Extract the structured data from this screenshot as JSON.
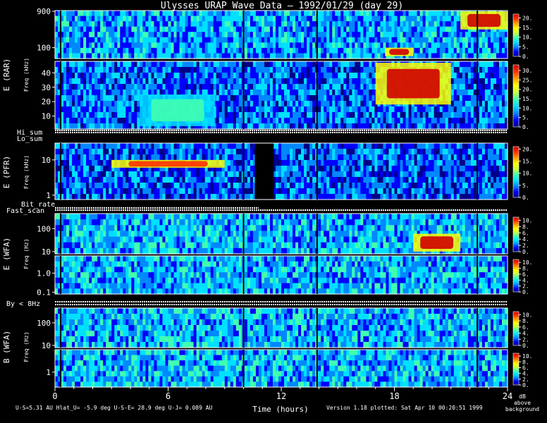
{
  "title": "Ulysses URAP Wave Data — 1992/01/29 (day 29)",
  "colors": {
    "background": "#000000",
    "text": "#ffffff",
    "colormap": [
      "#000088",
      "#0000ff",
      "#0088ff",
      "#00e0ff",
      "#40ffb0",
      "#c8ff40",
      "#ffff00",
      "#ffa000",
      "#ff3000",
      "#d00000"
    ]
  },
  "labels": {
    "e_rar": "E (RAR)",
    "e_pfr": "E (PFR)",
    "e_wfa": "E (WFA)",
    "b_wfa": "B (WFA)",
    "freq_khz": "Freq (kHz)",
    "freq_hz": "Freq (Hz)",
    "hi_sum": "Hi_sum",
    "lo_sum": "Lo_sum",
    "bit_rate": "Bit_rate",
    "fast_scan": "Fast_scan",
    "by_8hz": "By < 8Hz",
    "xlabel": "Time (hours)",
    "footer_left": "U-S=5.31 AU  Hlat_U= -5.9 deg  U-S-E= 28.9 deg  U-J= 0.089 AU",
    "footer_right": "Version 1.18 plotted: Sat Apr 10 00:20:51 1999",
    "cb_unit_1": "dB",
    "cb_unit_2": "above",
    "cb_unit_3": "background"
  },
  "chart_data": {
    "type": "heatmap",
    "title": "Ulysses URAP Wave Data — 1992/01/29 (day 29)",
    "xlabel": "Time (hours)",
    "xlim": [
      0,
      24
    ],
    "x_ticks": [
      0,
      6,
      12,
      18,
      24
    ],
    "x_tick_labels": [
      "0",
      "6",
      "12",
      "18",
      "24"
    ],
    "panels": [
      {
        "id": "rar_high",
        "instrument": "E (RAR)",
        "ylabel": "Freq (kHz)",
        "ylim": [
          52,
          940
        ],
        "y_scale": "log",
        "y_ticks": [
          100,
          900
        ],
        "y_tick_labels": [
          "100",
          "900"
        ],
        "colorbar": {
          "range": [
            0,
            22
          ],
          "ticks": [
            0,
            5,
            10,
            15,
            20
          ],
          "tick_labels": [
            "0.",
            "5.",
            "10.",
            "15.",
            "20."
          ]
        }
      },
      {
        "id": "rar_low",
        "instrument": "E (RAR)",
        "ylabel": "Freq (kHz)",
        "ylim": [
          1,
          48
        ],
        "y_scale": "linear",
        "y_ticks": [
          10,
          20,
          30,
          40
        ],
        "y_tick_labels": [
          "10",
          "20",
          "30",
          "40"
        ],
        "colorbar": {
          "range": [
            0,
            33
          ],
          "ticks": [
            0,
            5,
            10,
            15,
            20,
            25,
            30
          ],
          "tick_labels": [
            "0.",
            "5.",
            "10.",
            "15.",
            "20.",
            "25.",
            "30."
          ]
        }
      },
      {
        "id": "pfr",
        "instrument": "E (PFR)",
        "ylabel": "Freq (kHz)",
        "ylim": [
          0.75,
          30
        ],
        "y_scale": "log",
        "y_ticks": [
          1,
          10
        ],
        "y_tick_labels": [
          "1",
          "10"
        ],
        "colorbar": {
          "range": [
            0,
            21
          ],
          "ticks": [
            0,
            5,
            10,
            15,
            20
          ],
          "tick_labels": [
            "0.",
            "5.",
            "10.",
            "15.",
            "20."
          ]
        }
      },
      {
        "id": "wfa_e_high",
        "instrument": "E (WFA)",
        "ylabel": "Freq (Hz)",
        "ylim": [
          8,
          450
        ],
        "y_scale": "log",
        "y_ticks": [
          10,
          100
        ],
        "y_tick_labels": [
          "10",
          "100"
        ],
        "colorbar": {
          "range": [
            0,
            11
          ],
          "ticks": [
            0,
            2,
            4,
            6,
            8,
            10
          ],
          "tick_labels": [
            "0.",
            "2.",
            "4.",
            "6.",
            "8.",
            "10."
          ]
        }
      },
      {
        "id": "wfa_e_low",
        "instrument": "E (WFA)",
        "ylabel": "Freq (Hz)",
        "ylim": [
          0.08,
          8
        ],
        "y_scale": "log",
        "y_ticks": [
          0.1,
          1.0
        ],
        "y_tick_labels": [
          "0.1",
          "1.0"
        ],
        "colorbar": {
          "range": [
            0,
            11
          ],
          "ticks": [
            0,
            2,
            4,
            6,
            8,
            10
          ],
          "tick_labels": [
            "0.",
            "2.",
            "4.",
            "6.",
            "8.",
            "10."
          ]
        }
      },
      {
        "id": "wfa_b_high",
        "instrument": "B (WFA)",
        "ylabel": "Freq (Hz)",
        "ylim": [
          8,
          450
        ],
        "y_scale": "log",
        "y_ticks": [
          10,
          100
        ],
        "y_tick_labels": [
          "10",
          "100"
        ],
        "colorbar": {
          "range": [
            0,
            11
          ],
          "ticks": [
            0,
            2,
            4,
            6,
            8,
            10
          ],
          "tick_labels": [
            "0.",
            "2.",
            "4.",
            "6.",
            "8.",
            "10."
          ]
        }
      },
      {
        "id": "wfa_b_low",
        "instrument": "B (WFA)",
        "ylabel": "Freq (Hz)",
        "ylim": [
          0.25,
          8
        ],
        "y_scale": "log",
        "y_ticks": [
          1
        ],
        "y_tick_labels": [
          "1"
        ],
        "colorbar": {
          "range": [
            0,
            11
          ],
          "ticks": [
            0,
            2,
            4,
            6,
            8,
            10
          ],
          "tick_labels": [
            "0.",
            "2.",
            "4.",
            "6.",
            "8.",
            "10."
          ]
        }
      }
    ],
    "status_lines": [
      "Hi_sum",
      "Lo_sum",
      "Bit_rate",
      "Fast_scan",
      "By < 8Hz"
    ],
    "features": [
      {
        "panel": "rar_low",
        "hours": [
          17.0,
          21.0
        ],
        "freq_khz": [
          18,
          47
        ],
        "intensity_db": 30
      },
      {
        "panel": "rar_low",
        "hours": [
          4.5,
          8.5
        ],
        "freq_khz": [
          3,
          25
        ],
        "intensity_db": 15
      },
      {
        "panel": "rar_high",
        "hours": [
          17.5,
          19.0
        ],
        "freq_khz": [
          60,
          100
        ],
        "intensity_db": 20
      },
      {
        "panel": "rar_high",
        "hours": [
          21.5,
          24.0
        ],
        "freq_khz": [
          300,
          900
        ],
        "intensity_db": 20
      },
      {
        "panel": "pfr",
        "hours": [
          3.0,
          9.0
        ],
        "freq_khz": [
          6,
          10
        ],
        "intensity_db": 18
      },
      {
        "panel": "wfa_e_high",
        "hours": [
          19.0,
          21.5
        ],
        "freq_hz": [
          10,
          60
        ],
        "intensity_db": 10
      }
    ],
    "data_gap": {
      "panel": "pfr",
      "hours": [
        10.6,
        11.6
      ]
    }
  }
}
